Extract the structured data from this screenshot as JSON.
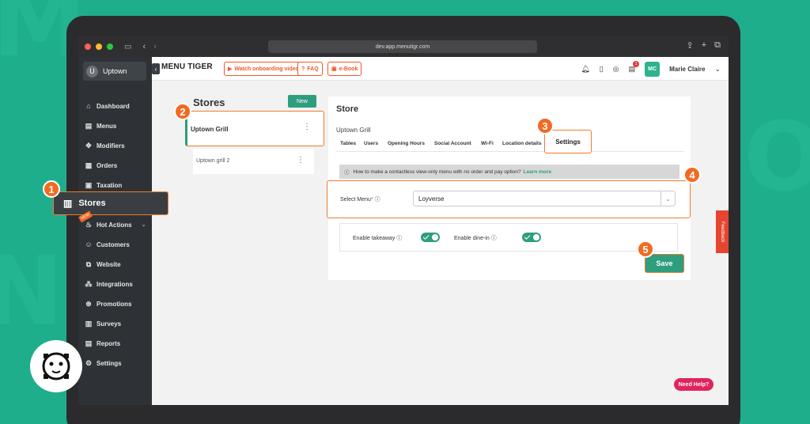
{
  "browser": {
    "url": "dev.app.menutigr.com"
  },
  "app": {
    "store_selector": {
      "avatar_letter": "U",
      "name": "Uptown"
    },
    "sidebar": {
      "items": [
        {
          "label": "Dashboard",
          "icon": "home-icon"
        },
        {
          "label": "Menus",
          "icon": "menu-book-icon"
        },
        {
          "label": "Modifiers",
          "icon": "move-icon"
        },
        {
          "label": "Orders",
          "icon": "clipboard-icon"
        },
        {
          "label": "Taxation",
          "icon": "calculator-icon"
        },
        {
          "label": "Stores",
          "icon": "store-icon"
        },
        {
          "label": "Hot Actions",
          "icon": "bell-icon",
          "badge": "NEW"
        },
        {
          "label": "Customers",
          "icon": "users-icon"
        },
        {
          "label": "Website",
          "icon": "website-icon"
        },
        {
          "label": "Integrations",
          "icon": "integrations-icon"
        },
        {
          "label": "Promotions",
          "icon": "promotion-icon"
        },
        {
          "label": "Surveys",
          "icon": "survey-icon"
        },
        {
          "label": "Reports",
          "icon": "report-icon"
        },
        {
          "label": "Settings",
          "icon": "gear-icon"
        }
      ]
    },
    "header": {
      "logo_text": "MENU TIGER",
      "buttons": [
        "Watch onboarding video",
        "FAQ",
        "e-Book"
      ],
      "notification_count": "1",
      "user_initials": "MC",
      "user_name": "Marie Claire"
    },
    "stores_panel": {
      "title": "Stores",
      "new_button": "New",
      "stores": [
        "Uptown Grill",
        "Uptown grill 2"
      ]
    },
    "store_panel": {
      "title": "Store",
      "store_name": "Uptown Grill",
      "tabs": [
        "Tables",
        "Users",
        "Opening Hours",
        "Social Account",
        "Wi-Fi",
        "Location details",
        "Settings"
      ],
      "info_text": "How to make a contactless view-only menu with no order and pay option?",
      "info_link": "Learn more",
      "select_menu_label": "Select Menu",
      "select_menu_value": "Loyverse",
      "enable_takeaway_label": "Enable takeaway",
      "enable_dinein_label": "Enable dine-in",
      "save_button": "Save"
    },
    "feedback_tab": "Feedback",
    "help_button": "Need Help?"
  },
  "steps": [
    "1",
    "2",
    "3",
    "4",
    "5"
  ],
  "colors": {
    "background": "#1fae8c",
    "accent": "#2e9e7e",
    "highlight": "#f26a21",
    "help": "#e0245e"
  }
}
